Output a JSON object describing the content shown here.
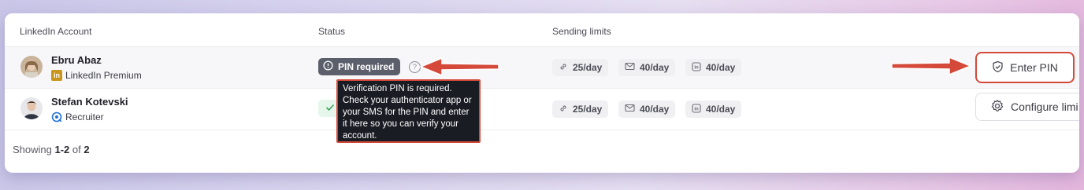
{
  "table": {
    "headers": {
      "account": "LinkedIn Account",
      "status": "Status",
      "limits": "Sending limits"
    },
    "rows": [
      {
        "name": "Ebru Abaz",
        "subscription": "LinkedIn Premium",
        "subscription_icon": "linkedin-icon",
        "status": "PIN required",
        "status_icon": "alert-circle-icon",
        "limits": {
          "connections": "25/day",
          "messages": "40/day",
          "inmails": "40/day"
        },
        "action": "Enter PIN",
        "action_icon": "shield-check-icon"
      },
      {
        "name": "Stefan Kotevski",
        "subscription": "Recruiter",
        "subscription_icon": "recruiter-icon",
        "status_icon": "check-icon",
        "limits": {
          "connections": "25/day",
          "messages": "40/day",
          "inmails": "40/day"
        },
        "action": "Configure limi",
        "action_icon": "gear-icon"
      }
    ]
  },
  "tooltip": {
    "text": "Verification PIN is required. Check your authenticator app or your SMS for the PIN and enter it here so you can verify your account."
  },
  "pagination": {
    "prefix": "Showing ",
    "range": "1-2",
    "of": " of ",
    "total": "2"
  },
  "colors": {
    "annotation_red": "#d4493a",
    "status_pill": "#5b5f6b",
    "premium_gold": "#c9951c"
  }
}
